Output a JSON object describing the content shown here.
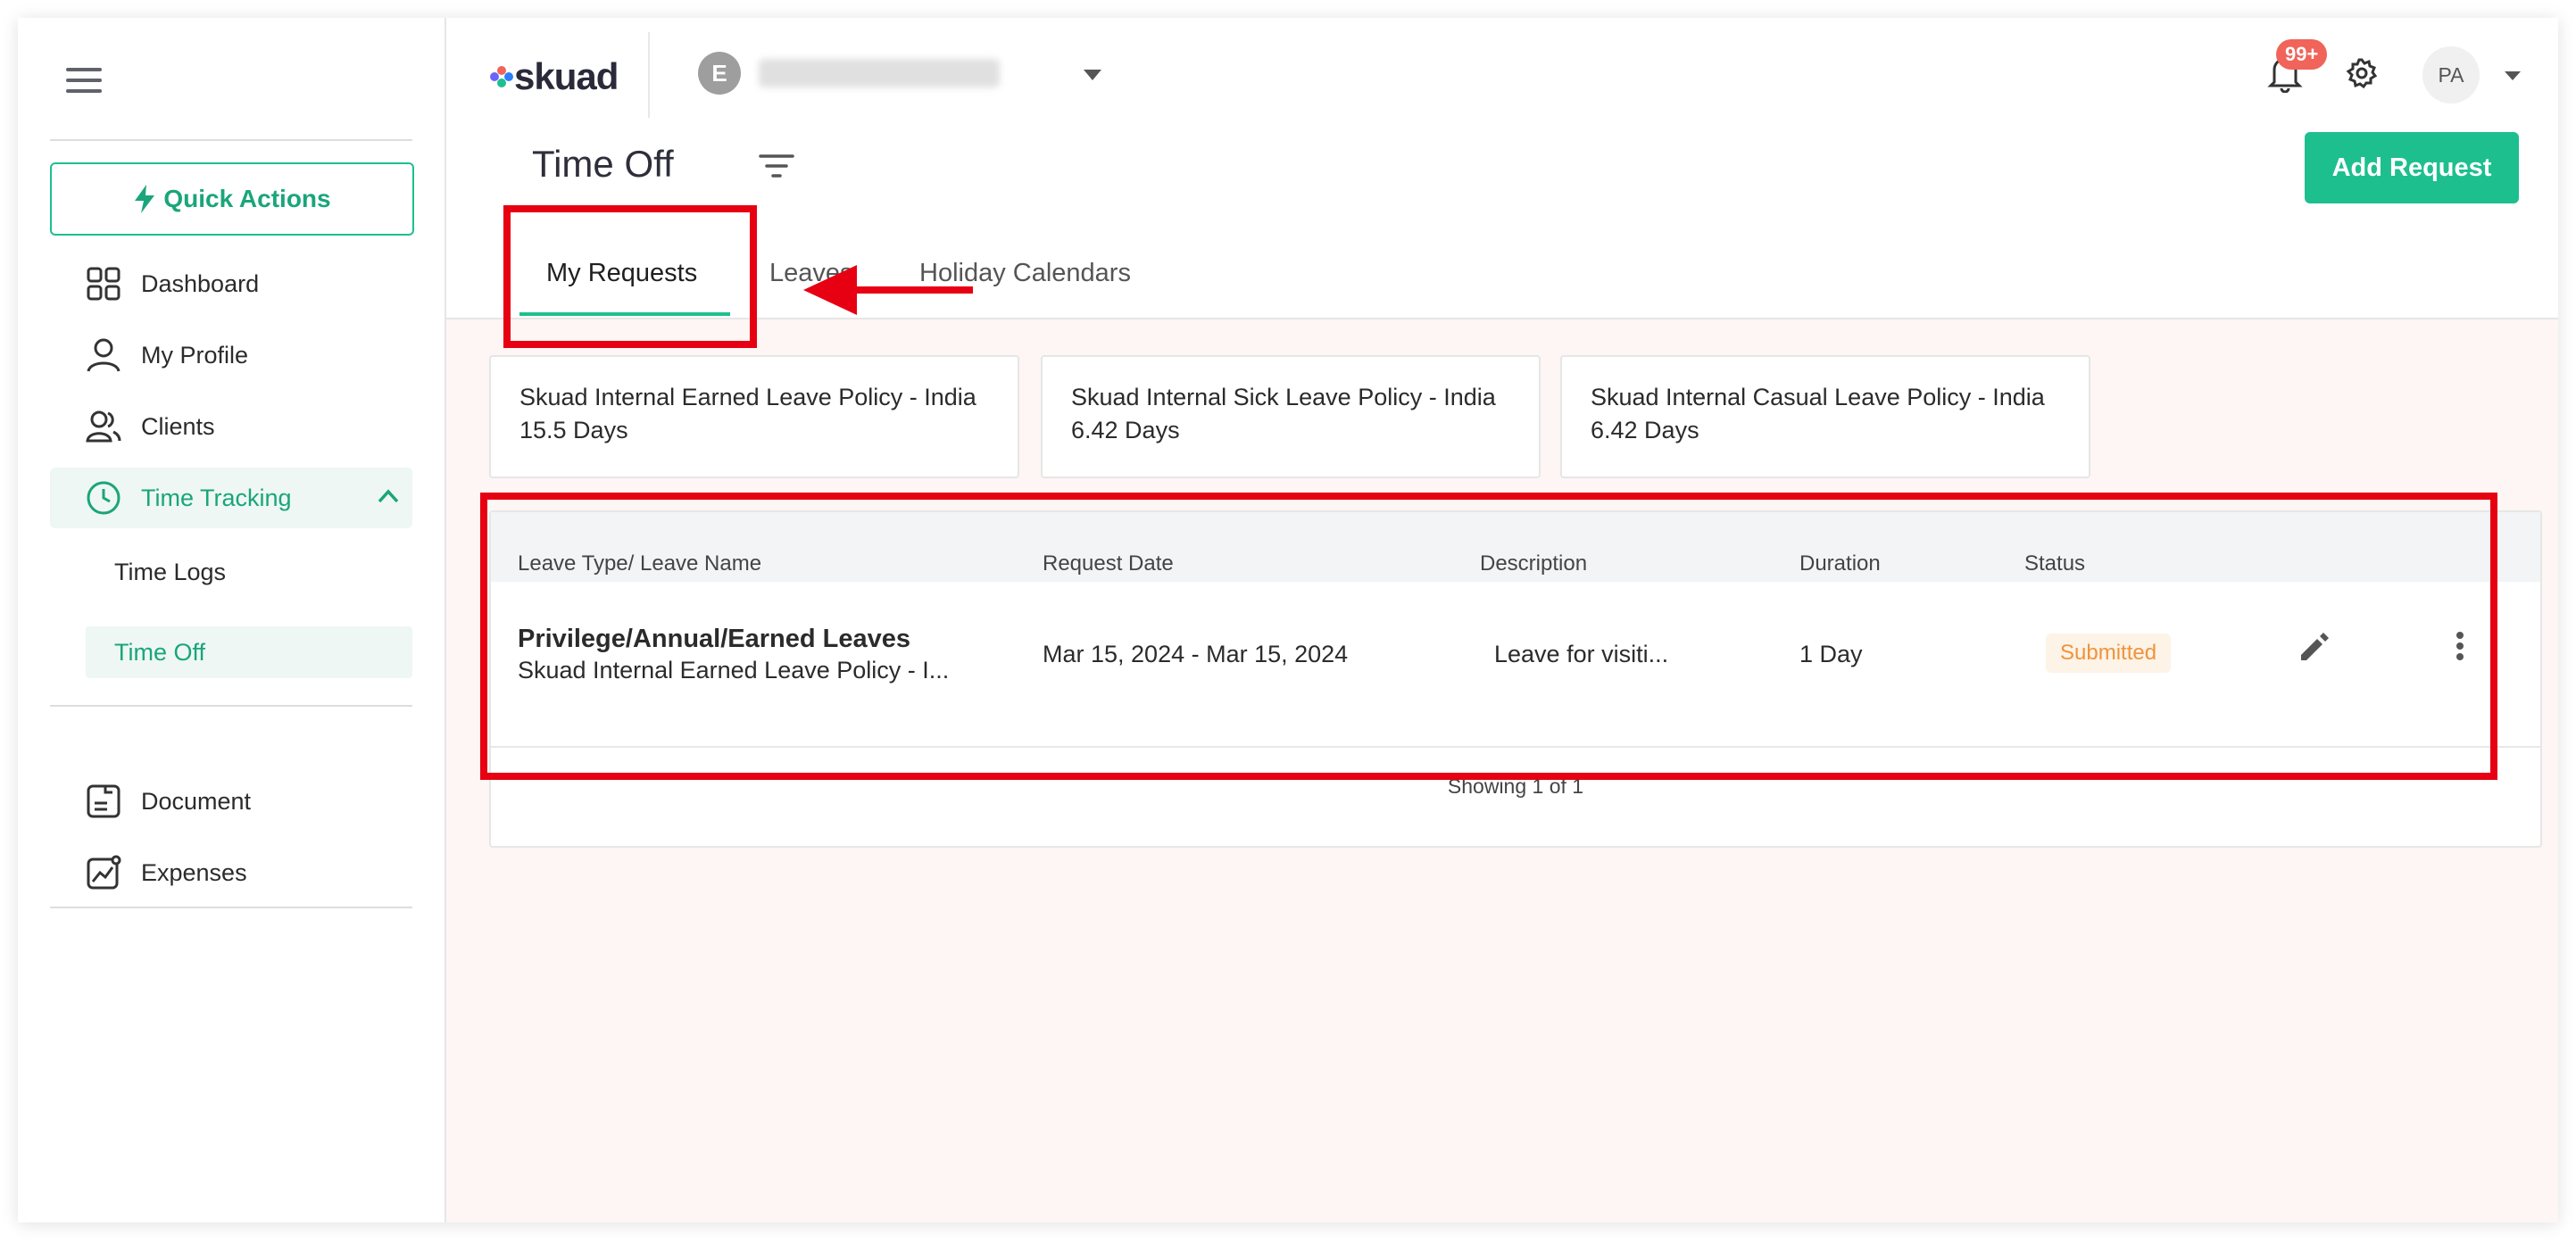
{
  "app": {
    "logo_text": "skuad"
  },
  "header": {
    "entity_initial": "E",
    "notifications_badge": "99+",
    "user_initials": "PA"
  },
  "sidebar": {
    "quick_actions_label": "Quick Actions",
    "items": [
      {
        "label": "Dashboard",
        "icon": "dashboard-icon"
      },
      {
        "label": "My Profile",
        "icon": "profile-icon"
      },
      {
        "label": "Clients",
        "icon": "clients-icon"
      },
      {
        "label": "Time Tracking",
        "icon": "clock-icon"
      }
    ],
    "sub_items": [
      {
        "label": "Time Logs"
      },
      {
        "label": "Time Off"
      }
    ],
    "lower_items": [
      {
        "label": "Document",
        "icon": "document-icon"
      },
      {
        "label": "Expenses",
        "icon": "expenses-icon"
      }
    ]
  },
  "page": {
    "title": "Time Off",
    "add_request_label": "Add Request",
    "tabs": [
      {
        "label": "My Requests"
      },
      {
        "label": "Leaves"
      },
      {
        "label": "Holiday Calendars"
      }
    ]
  },
  "policies": [
    {
      "name": "Skuad Internal Earned Leave Policy - India",
      "days": "15.5 Days"
    },
    {
      "name": "Skuad Internal Sick Leave Policy - India",
      "days": "6.42 Days"
    },
    {
      "name": "Skuad Internal Casual Leave Policy - India",
      "days": "6.42 Days"
    }
  ],
  "table": {
    "columns": [
      "Leave Type/ Leave Name",
      "Request Date",
      "Description",
      "Duration",
      "Status"
    ],
    "rows": [
      {
        "leave_type": "Privilege/Annual/Earned Leaves",
        "leave_name": "Skuad Internal Earned Leave Policy - I...",
        "request_date": "Mar 15, 2024 - Mar 15, 2024",
        "description": "Leave for visiti...",
        "duration": "1 Day",
        "status": "Submitted"
      }
    ],
    "footer": "Showing 1 of 1"
  },
  "colors": {
    "brand": "#1dbf8e",
    "annotation": "#e60012",
    "status_submitted": "#f0933b"
  }
}
